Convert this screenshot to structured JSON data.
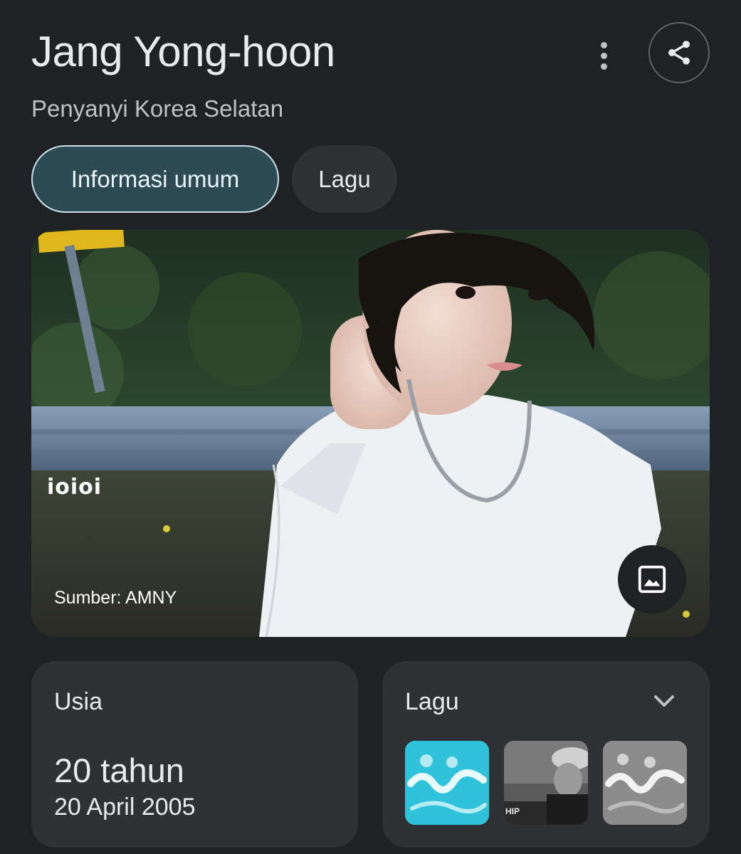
{
  "header": {
    "title": "Jang Yong-hoon",
    "subtitle": "Penyanyi Korea Selatan",
    "more_icon": "more-vert-icon",
    "share_icon": "share-icon"
  },
  "tabs": [
    {
      "label": "Informasi umum",
      "selected": true
    },
    {
      "label": "Lagu",
      "selected": false
    }
  ],
  "photo": {
    "watermark": "ioioi",
    "source": "Sumber: AMNY",
    "image_icon": "image-icon"
  },
  "age_card": {
    "label": "Usia",
    "age": "20 tahun",
    "birthdate": "20 April 2005"
  },
  "songs_card": {
    "label": "Lagu",
    "chevron_icon": "chevron-down-icon",
    "thumbnail_2_text": "HIP"
  },
  "colors": {
    "background": "#202124",
    "card": "#303134",
    "selected_chip": "#2e4a52",
    "selected_chip_border": "#c9e3ea"
  }
}
